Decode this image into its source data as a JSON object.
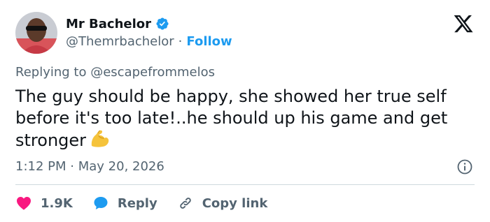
{
  "author": {
    "display_name": "Mr Bachelor",
    "handle": "@Themrbachelor",
    "separator": "·",
    "follow_label": "Follow",
    "verified": true
  },
  "brand": {
    "logo": "x-logo-icon"
  },
  "reply_context": {
    "prefix": "Replying to",
    "mention": "@escapefrommelos"
  },
  "tweet": {
    "text": "The guy should be happy, she showed her true self before it's too late!..he should up his game and get stronger",
    "emoji": "flexed-biceps-icon"
  },
  "meta": {
    "time": "1:12 PM",
    "separator": "·",
    "date": "May 20, 2026"
  },
  "actions": {
    "like_count": "1.9K",
    "reply_label": "Reply",
    "copy_link_label": "Copy link"
  },
  "colors": {
    "accent": "#1d9bf0",
    "like": "#f91880",
    "text": "#0f1419",
    "secondary": "#536471",
    "divider": "#cfd9de"
  }
}
